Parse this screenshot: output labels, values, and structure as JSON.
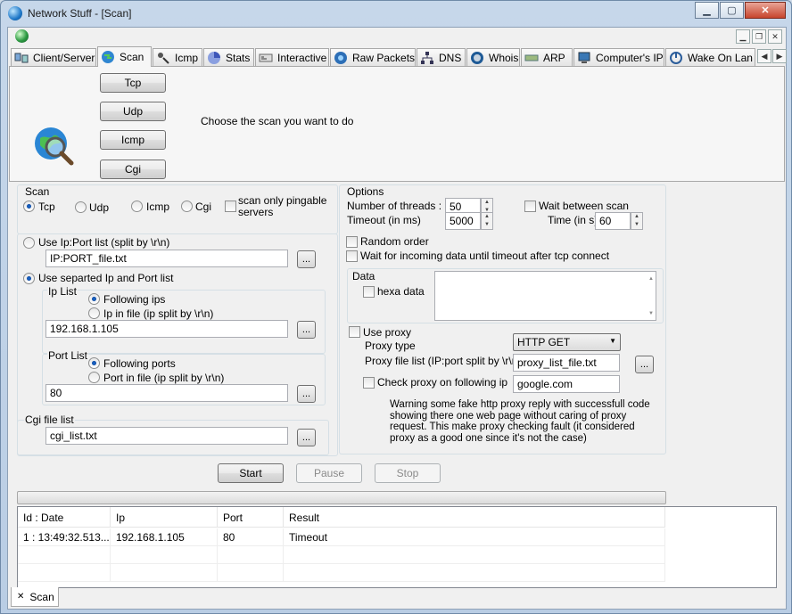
{
  "window": {
    "title": "Network Stuff - [Scan]"
  },
  "tabs": [
    {
      "label": "Client/Server",
      "icon": "client-server-icon"
    },
    {
      "label": "Scan",
      "icon": "globe-icon"
    },
    {
      "label": "Icmp",
      "icon": "icmp-icon"
    },
    {
      "label": "Stats",
      "icon": "stats-icon"
    },
    {
      "label": "Interactive",
      "icon": "terminal-icon"
    },
    {
      "label": "Raw Packets",
      "icon": "packets-icon"
    },
    {
      "label": "DNS",
      "icon": "network-tree-icon"
    },
    {
      "label": "Whois",
      "icon": "whois-icon"
    },
    {
      "label": "ARP",
      "icon": "arp-icon"
    },
    {
      "label": "Computer's IP",
      "icon": "computer-icon"
    },
    {
      "label": "Wake On Lan",
      "icon": "power-icon"
    }
  ],
  "scan_type_panel": {
    "buttons": [
      "Tcp",
      "Udp",
      "Icmp",
      "Cgi"
    ],
    "prompt": "Choose the scan you want to do"
  },
  "scan_group": {
    "title": "Scan",
    "options": [
      "Tcp",
      "Udp",
      "Icmp",
      "Cgi"
    ],
    "selected": "Tcp",
    "pingable_label": "scan only pingable servers"
  },
  "ipport": {
    "use_list_label": "Use Ip:Port list (split by \\r\\n)",
    "list_file": "IP:PORT_file.txt",
    "use_separated_label": "Use separted  Ip and Port list",
    "ip_list_title": "Ip List",
    "ip_following": "Following ips",
    "ip_in_file": "Ip in file (ip split by \\r\\n)",
    "ip_value": "192.168.1.105",
    "port_list_title": "Port List",
    "port_following": "Following ports",
    "port_in_file": "Port in file (ip split by \\r\\n)",
    "port_value": "80",
    "cgi_title": "Cgi file list",
    "cgi_value": "cgi_list.txt",
    "browse": "..."
  },
  "options": {
    "title": "Options",
    "threads_label": "Number of threads :",
    "threads_value": "50",
    "timeout_label": "Timeout (in ms)",
    "timeout_value": "5000",
    "wait_label": "Wait between scan",
    "time_label": "Time (in s)",
    "time_value": "60",
    "random_label": "Random order",
    "wait_incoming_label": "Wait for incoming data until timeout after tcp connect",
    "data_title": "Data",
    "hexa_label": "hexa data",
    "use_proxy_label": "Use proxy",
    "proxy_type_label": "Proxy type",
    "proxy_type_value": "HTTP GET",
    "proxy_file_label": "Proxy file list (IP:port split by \\r\\n)",
    "proxy_file_value": "proxy_list_file.txt",
    "check_proxy_label": "Check proxy on following ip",
    "check_proxy_value": "google.com",
    "warning": "Warning some fake http proxy reply with successfull code showing there one web page without caring of proxy request. This make proxy checking fault (it considered proxy as a good one since it's not the case)"
  },
  "actions": {
    "start": "Start",
    "pause": "Pause",
    "stop": "Stop"
  },
  "progress": 0,
  "results": {
    "columns": [
      "Id : Date",
      "Ip",
      "Port",
      "Result"
    ],
    "rows": [
      [
        "1 : 13:49:32.513...",
        "192.168.1.105",
        "80",
        "Timeout"
      ]
    ]
  },
  "bottom_tab": {
    "label": "Scan",
    "close_glyph": "✕"
  }
}
